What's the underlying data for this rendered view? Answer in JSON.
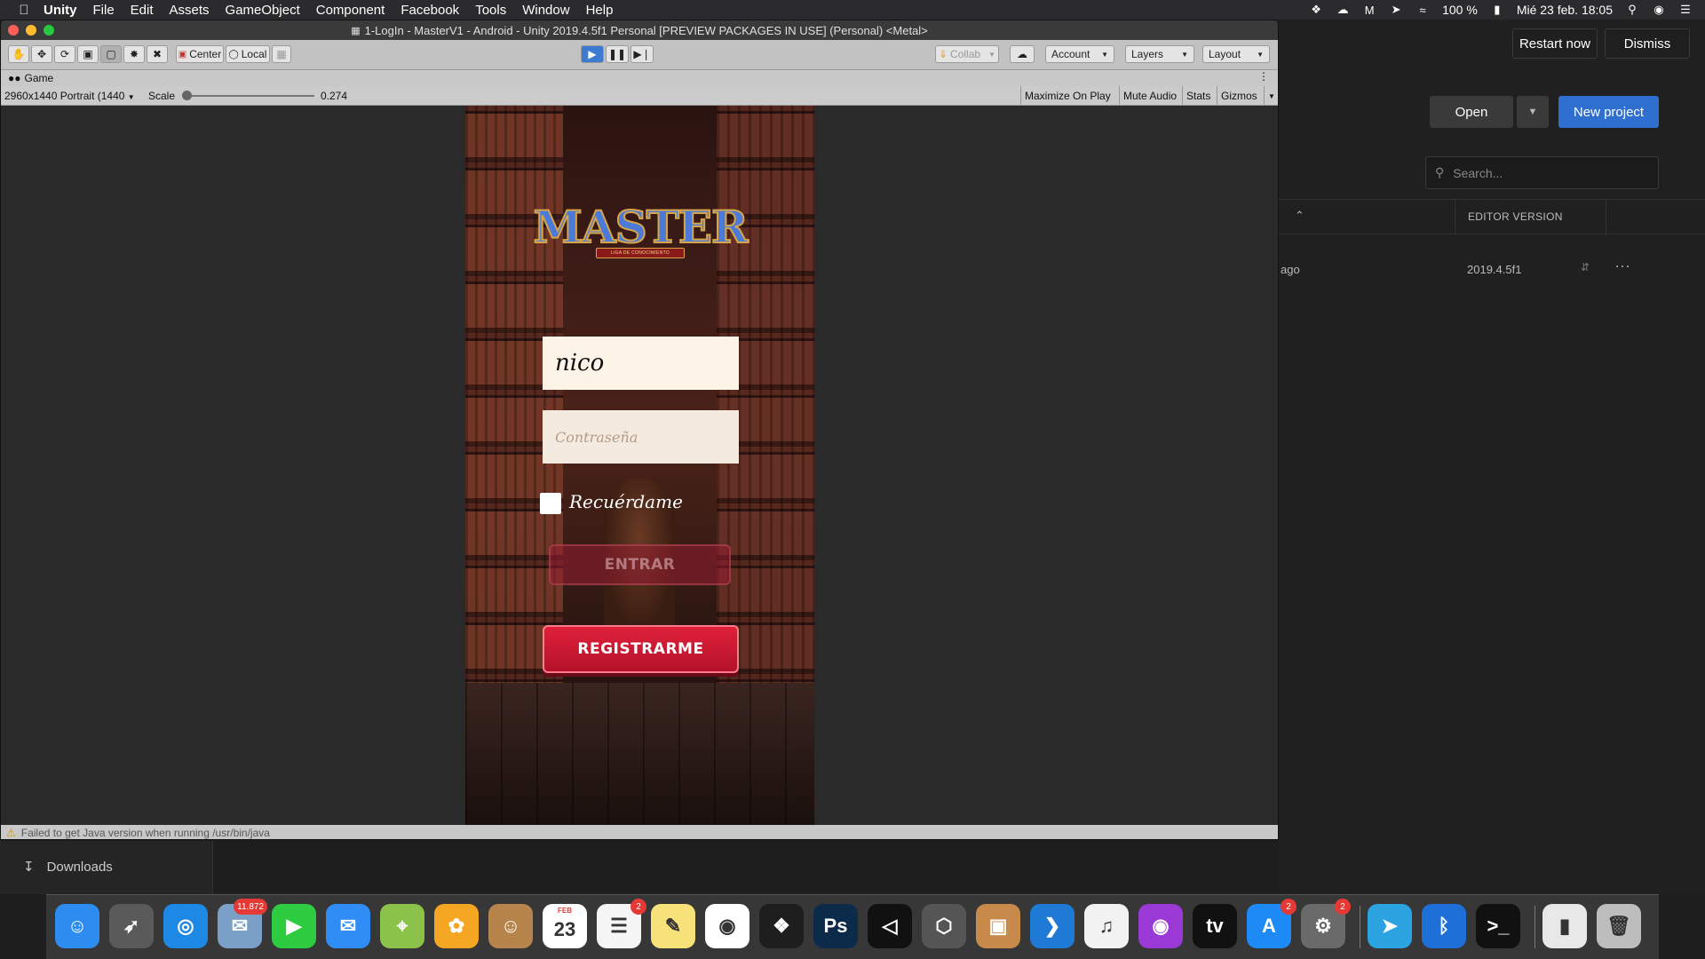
{
  "menubar": {
    "app": "Unity",
    "items": [
      "File",
      "Edit",
      "Assets",
      "GameObject",
      "Component",
      "Facebook",
      "Tools",
      "Window",
      "Help"
    ],
    "battery": "100 %",
    "datetime": "Mié 23 feb.  18:05"
  },
  "editor": {
    "title": "1-LogIn - MasterV1 - Android - Unity 2019.4.5f1 Personal [PREVIEW PACKAGES IN USE] (Personal) <Metal>",
    "toolbar": {
      "center": "Center",
      "local": "Local",
      "collab": "Collab",
      "account": "Account",
      "layers": "Layers",
      "layout": "Layout"
    },
    "game_tab": "Game",
    "game_bar": {
      "resolution": "2960x1440 Portrait (1440",
      "scale_label": "Scale",
      "scale_value": "0.274",
      "scale_fraction": 0.274,
      "maximize": "Maximize On Play",
      "mute": "Mute Audio",
      "stats": "Stats",
      "gizmos": "Gizmos"
    },
    "status": "Failed to get Java version when running /usr/bin/java"
  },
  "game": {
    "logo": "MASTER",
    "logo_subtitle": "LIGA DE CONOCIMIENTO",
    "username_value": "nico",
    "password_placeholder": "Contraseña",
    "remember_label": "Recuérdame",
    "remember_checked": false,
    "login_button": "ENTRAR",
    "register_button": "REGISTRARME"
  },
  "hub": {
    "restart": "Restart now",
    "dismiss": "Dismiss",
    "open": "Open",
    "new_project": "New project",
    "search_placeholder": "Search...",
    "col_editor_version": "EDITOR VERSION",
    "row_modified": "ago",
    "row_version": "2019.4.5f1"
  },
  "finder": {
    "downloads": "Downloads"
  },
  "dock": {
    "apps": [
      {
        "name": "finder-icon",
        "color": "#2d8cf0"
      },
      {
        "name": "launchpad-icon",
        "color": "#5a5a5a"
      },
      {
        "name": "safari-icon",
        "color": "#1e88e5"
      },
      {
        "name": "mail-icon",
        "color": "#7aa0c8",
        "badge": "11.872"
      },
      {
        "name": "facetime-icon",
        "color": "#2ecc40"
      },
      {
        "name": "messages-icon",
        "color": "#2f8df5"
      },
      {
        "name": "maps-icon",
        "color": "#8bc34a"
      },
      {
        "name": "photos-icon",
        "color": "#f5a623"
      },
      {
        "name": "contacts-icon",
        "color": "#b7844c"
      },
      {
        "name": "calendar-icon",
        "color": "#ffffff",
        "text": "23",
        "subtext": "FEB"
      },
      {
        "name": "reminders-icon",
        "color": "#f5f5f5",
        "badge": "2"
      },
      {
        "name": "notes-icon",
        "color": "#f7e27a"
      },
      {
        "name": "chrome-icon",
        "color": "#ffffff"
      },
      {
        "name": "figma-icon",
        "color": "#1e1e1e"
      },
      {
        "name": "photoshop-icon",
        "color": "#0c2a4a",
        "text": "Ps"
      },
      {
        "name": "unity-icon",
        "color": "#111111"
      },
      {
        "name": "unity-hub-icon",
        "color": "#555555"
      },
      {
        "name": "package-icon",
        "color": "#c88a4a"
      },
      {
        "name": "vscode-icon",
        "color": "#1f7ad6"
      },
      {
        "name": "music-icon",
        "color": "#f2f2f2"
      },
      {
        "name": "podcasts-icon",
        "color": "#9b39d6"
      },
      {
        "name": "appletv-icon",
        "color": "#111111",
        "text": "tv"
      },
      {
        "name": "appstore-icon",
        "color": "#1d8af5",
        "badge": "2"
      },
      {
        "name": "system-preferences-icon",
        "color": "#6a6a6a",
        "badge": "2"
      },
      {
        "name": "telegram-icon",
        "color": "#2aa3e0"
      },
      {
        "name": "bluetooth-icon",
        "color": "#1e6fd8"
      },
      {
        "name": "terminal-icon",
        "color": "#111111"
      },
      {
        "name": "archive-icon",
        "color": "#e8e8e8"
      },
      {
        "name": "trash-icon",
        "color": "#bdbdbd"
      }
    ]
  }
}
